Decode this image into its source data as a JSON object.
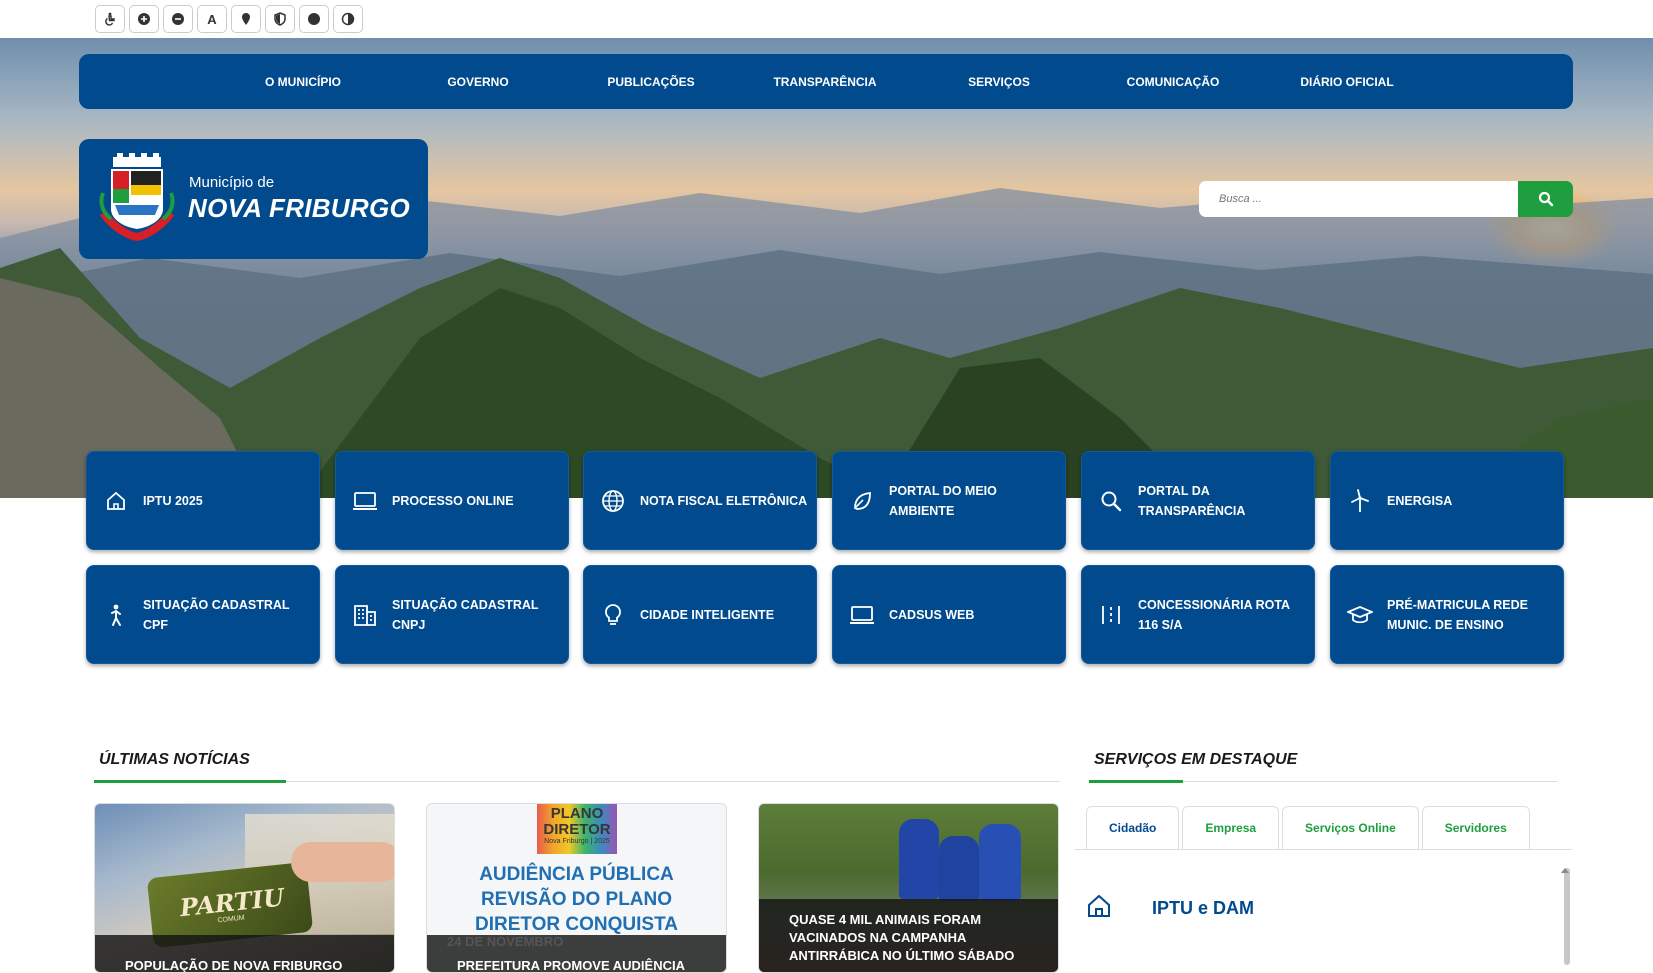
{
  "accessibility_bar": {
    "buttons": [
      "accessibility-icon",
      "zoom-in-icon",
      "zoom-out-icon",
      "A",
      "location-icon",
      "shield-icon",
      "dark-mode-icon",
      "contrast-icon"
    ],
    "font_button_label": "A"
  },
  "nav": {
    "items": [
      "O MUNICÍPIO",
      "GOVERNO",
      "PUBLICAÇÕES",
      "TRANSPARÊNCIA",
      "SERVIÇOS",
      "COMUNICAÇÃO",
      "DIÁRIO OFICIAL"
    ]
  },
  "logo": {
    "subtitle": "Município de",
    "title": "NOVA FRIBURGO"
  },
  "search": {
    "placeholder": "Busca ..."
  },
  "quick_links": {
    "row1": [
      {
        "label": "IPTU 2025",
        "icon": "home-icon"
      },
      {
        "label": "PROCESSO ONLINE",
        "icon": "laptop-icon"
      },
      {
        "label": "NOTA FISCAL ELETRÔNICA",
        "icon": "globe-icon"
      },
      {
        "label": "PORTAL DO MEIO AMBIENTE",
        "icon": "leaf-icon"
      },
      {
        "label": "PORTAL DA TRANSPARÊNCIA",
        "icon": "search-icon"
      },
      {
        "label": "ENERGISA",
        "icon": "wind-turbine-icon"
      }
    ],
    "row2": [
      {
        "label": "SITUAÇÃO CADASTRAL CPF",
        "icon": "person-icon"
      },
      {
        "label": "SITUAÇÃO CADASTRAL CNPJ",
        "icon": "building-icon"
      },
      {
        "label": "CIDADE INTELIGENTE",
        "icon": "lightbulb-icon"
      },
      {
        "label": "CADSUS WEB",
        "icon": "laptop-icon"
      },
      {
        "label": "CONCESSIONÁRIA ROTA 116 S/A",
        "icon": "road-icon"
      },
      {
        "label": "PRÉ-MATRICULA REDE MUNIC. DE ENSINO",
        "icon": "graduation-cap-icon"
      }
    ]
  },
  "news": {
    "title": "ÚLTIMAS NOTÍCIAS",
    "cards": [
      {
        "caption": "POPULAÇÃO DE NOVA FRIBURGO",
        "image_text": "PARTIU",
        "image_subtext": "COMUM"
      },
      {
        "caption": "PREFEITURA PROMOVE AUDIÊNCIA",
        "image_text": "AUDIÊNCIA PÚBLICA REVISÃO DO PLANO DIRETOR CONQUISTA",
        "logo_text": "PLANO DIRETOR",
        "logo_sub": "Nova Friburgo | 2025",
        "date": "24 DE NOVEMBRO"
      },
      {
        "caption": "QUASE 4 MIL ANIMAIS FORAM VACINADOS NA CAMPANHA ANTIRRÁBICA NO ÚLTIMO SÁBADO"
      }
    ]
  },
  "featured_services": {
    "title": "SERVIÇOS EM DESTAQUE",
    "tabs": [
      "Cidadão",
      "Empresa",
      "Serviços Online",
      "Servidores"
    ],
    "items": [
      {
        "label": "IPTU e DAM",
        "icon": "home-icon"
      }
    ]
  },
  "colors": {
    "primary": "#004a8d",
    "accent": "#1e9e3e"
  }
}
